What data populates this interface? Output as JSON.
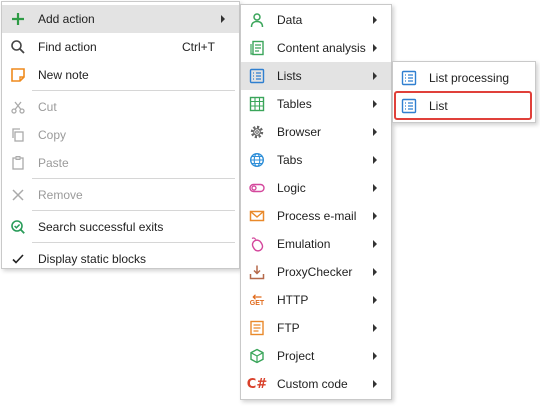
{
  "context_menu": {
    "items": [
      {
        "label": "Add action",
        "icon": "plus-icon"
      },
      {
        "label": "Find action",
        "shortcut": "Ctrl+T",
        "icon": "magnifier-icon"
      },
      {
        "label": "New note",
        "icon": "note-icon"
      },
      {
        "label": "Cut",
        "icon": "scissors-icon"
      },
      {
        "label": "Copy",
        "icon": "copy-icon"
      },
      {
        "label": "Paste",
        "icon": "paste-icon"
      },
      {
        "label": "Remove",
        "icon": "cross-icon"
      },
      {
        "label": "Search successful exits",
        "icon": "search-check-icon"
      },
      {
        "label": "Display static blocks",
        "icon": "checkmark-icon"
      }
    ]
  },
  "add_action_submenu": {
    "items": [
      {
        "label": "Data",
        "icon": "person-icon"
      },
      {
        "label": "Content analysis",
        "icon": "document-icon"
      },
      {
        "label": "Lists",
        "icon": "list-icon"
      },
      {
        "label": "Tables",
        "icon": "table-icon"
      },
      {
        "label": "Browser",
        "icon": "gear-icon"
      },
      {
        "label": "Tabs",
        "icon": "globe-icon"
      },
      {
        "label": "Logic",
        "icon": "toggle-icon"
      },
      {
        "label": "Process e-mail",
        "icon": "envelope-icon"
      },
      {
        "label": "Emulation",
        "icon": "mouse-icon"
      },
      {
        "label": "ProxyChecker",
        "icon": "download-tray-icon"
      },
      {
        "label": "HTTP",
        "icon": "http-get-icon",
        "icon_text": "GET"
      },
      {
        "label": "FTP",
        "icon": "ftp-icon"
      },
      {
        "label": "Project",
        "icon": "cube-icon"
      },
      {
        "label": "Custom code",
        "icon": "csharp-icon",
        "icon_text": "C#"
      }
    ]
  },
  "lists_submenu": {
    "items": [
      {
        "label": "List processing",
        "icon": "list-icon"
      },
      {
        "label": "List",
        "icon": "list-icon"
      }
    ]
  },
  "colors": {
    "highlight": "#e3e3e3",
    "callout_border": "#e0403a",
    "icon_blue": "#2f7fd0",
    "icon_green": "#3aa55a",
    "icon_orange": "#e9892a"
  }
}
